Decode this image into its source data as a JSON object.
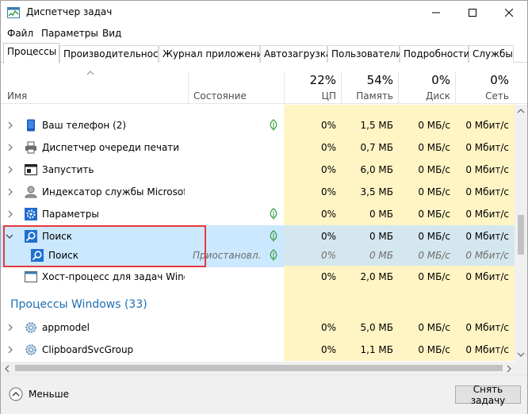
{
  "window": {
    "title": "Диспетчер задач"
  },
  "menu": [
    "Файл",
    "Параметры",
    "Вид"
  ],
  "tabs": [
    "Процессы",
    "Производительность",
    "Журнал приложений",
    "Автозагрузка",
    "Пользователи",
    "Подробности",
    "Службы"
  ],
  "header": {
    "name": "Имя",
    "status": "Состояние",
    "cpu_pct": "22%",
    "cpu_label": "ЦП",
    "mem_pct": "54%",
    "mem_label": "Память",
    "disk_pct": "0%",
    "disk_label": "Диск",
    "net_pct": "0%",
    "net_label": "Сеть"
  },
  "rows": [
    {
      "name": "Ваш телефон (2)",
      "icon": "phone-icon",
      "cpu": "0%",
      "mem": "1,5 МБ",
      "disk": "0 МБ/с",
      "net": "0 Мбит/с",
      "leaf": true
    },
    {
      "name": "Диспетчер очереди печати",
      "icon": "printer-icon",
      "cpu": "0%",
      "mem": "0,7 МБ",
      "disk": "0 МБ/с",
      "net": "0 Мбит/с",
      "leaf": false
    },
    {
      "name": "Запустить",
      "icon": "run-icon",
      "cpu": "0%",
      "mem": "6,0 МБ",
      "disk": "0 МБ/с",
      "net": "0 Мбит/с",
      "leaf": false
    },
    {
      "name": "Индексатор службы Microsoft ...",
      "icon": "indexer-icon",
      "cpu": "0%",
      "mem": "3,5 МБ",
      "disk": "0 МБ/с",
      "net": "0 Мбит/с",
      "leaf": false
    },
    {
      "name": "Параметры",
      "icon": "gear-icon",
      "cpu": "0%",
      "mem": "0 МБ",
      "disk": "0 МБ/с",
      "net": "0 Мбит/с",
      "leaf": true
    },
    {
      "name": "Поиск",
      "icon": "search-icon",
      "cpu": "0%",
      "mem": "0 МБ",
      "disk": "0 МБ/с",
      "net": "0 Мбит/с",
      "leaf": true
    },
    {
      "name": "Поиск",
      "icon": "search-icon",
      "status": "Приостановл...",
      "cpu": "0%",
      "mem": "0 МБ",
      "disk": "0 МБ/с",
      "net": "0 Мбит/с",
      "leaf": true
    },
    {
      "name": "Хост-процесс для задач Windo...",
      "icon": "host-icon",
      "cpu": "0%",
      "mem": "2,0 МБ",
      "disk": "0 МБ/с",
      "net": "0 Мбит/с",
      "leaf": false
    }
  ],
  "group": {
    "title": "Процессы Windows (33)"
  },
  "win_rows": [
    {
      "name": "appmodel",
      "icon": "gear-icon",
      "cpu": "0%",
      "mem": "5,0 МБ",
      "disk": "0 МБ/с",
      "net": "0 Мбит/с"
    },
    {
      "name": "ClipboardSvcGroup",
      "icon": "gear-icon",
      "cpu": "0%",
      "mem": "1,1 МБ",
      "disk": "0 МБ/с",
      "net": "0 Мбит/с"
    }
  ],
  "footer": {
    "less": "Меньше",
    "end_task": "Снять задачу"
  },
  "colors": {
    "accent": "#1f6fb2",
    "highlight": "#e8383d",
    "selection": "#cce8ff",
    "resource_bg": "#fff4c4"
  }
}
